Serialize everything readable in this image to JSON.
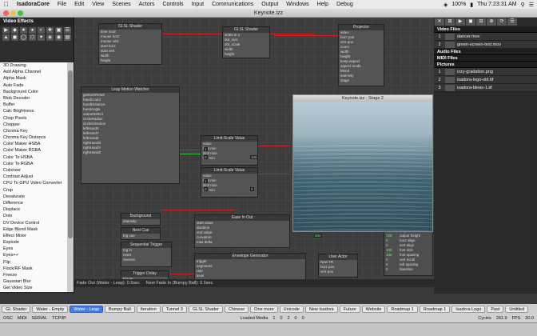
{
  "menubar": {
    "app_name": "IsadoraCore",
    "items": [
      "File",
      "Edit",
      "View",
      "Scenes",
      "Actors",
      "Controls",
      "Input",
      "Communications",
      "Output",
      "Windows",
      "Help",
      "Debug"
    ],
    "battery": "100%",
    "clock": "Thu 7:23:31 AM"
  },
  "window": {
    "title": "Keynote.izz"
  },
  "left_panel": {
    "title": "Video Effects",
    "icons": [
      "▶",
      "◆",
      "★",
      "●",
      "◐",
      "✚",
      "▣",
      "☰",
      "▲",
      "◼",
      "◯",
      "⬡",
      "✦",
      "◈",
      "◉",
      "▤"
    ],
    "actors": [
      "3D Drawing",
      "Add Alpha Channel",
      "Alpha Mask",
      "Auto Fade",
      "Background Color",
      "Blob Decoder",
      "Buffer",
      "Calc Brightness",
      "Chop Pixels",
      "Chopper",
      "Chroma Key",
      "Chroma Key Distance",
      "Color Maker HSBA",
      "Color Maker RGBA",
      "Color To HSBA",
      "Color To RGBA",
      "Colorizer",
      "Contrast Adjust",
      "CPU To GPU Video Converter",
      "Crop",
      "Desaturate",
      "Difference",
      "Displace",
      "Dots",
      "DV Device Control",
      "Edge Blend Mask",
      "Effect Mixer",
      "Explode",
      "Eyes",
      "Eyes++",
      "Flip",
      "Flock/RF Mask",
      "Freeze",
      "Gaussian Blur",
      "Get Video Size"
    ]
  },
  "patch": {
    "actors": [
      {
        "title": "GLSL Shader",
        "rows": [
          "time mod",
          "mouse horz",
          "mouse vert",
          "start horz",
          "start vert",
          "width",
          "height"
        ]
      },
      {
        "title": "GLSL Shader",
        "rows": [
          "video in 1",
          "dot_size",
          "dot_scale",
          "width",
          "height"
        ]
      },
      {
        "title": "Projector",
        "rows": [
          "video",
          "horz pos",
          "vert pos",
          "zoom",
          "width",
          "height",
          "keep aspect",
          "aspect mode",
          "blend",
          "intensity",
          "stage"
        ]
      },
      {
        "title": "Leap Motion Watcher",
        "rows": [
          "gestureReset",
          "handCount",
          "handDistance",
          "handAngle",
          "outputSelect",
          "circleRadius",
          "circleDirection",
          "leftHandX",
          "leftHandY",
          "leftHandZ",
          "rightHandX",
          "rightHandY",
          "rightHandZ"
        ]
      },
      {
        "title": "Limit-Scale Value",
        "rows": [
          "value",
          "limit min",
          "limit max",
          "out min",
          "out max"
        ]
      },
      {
        "title": "Limit-Scale Value",
        "rows": [
          "value",
          "limit min",
          "limit max",
          "out min",
          "out max"
        ]
      },
      {
        "title": "Background",
        "rows": [
          "intensity"
        ]
      },
      {
        "title": "Next Cue",
        "rows": [
          "trig cue"
        ]
      },
      {
        "title": "Sequential Trigger",
        "rows": [
          "trig in",
          "reset",
          "reverse",
          "output"
        ]
      },
      {
        "title": "Trigger Delay",
        "rows": [
          "trigger",
          "delay"
        ]
      },
      {
        "title": "Ease In Out",
        "rows": [
          "start value",
          "duration",
          "end value",
          "curvature",
          "max delta",
          "trigger"
        ]
      },
      {
        "title": "Envelope Generator",
        "rows": [
          "trigger",
          "segments",
          "rate",
          "level",
          "value 0",
          "value 1"
        ]
      },
      {
        "title": "User Actor",
        "rows": [
          "New TR",
          "horz pos",
          "vert pos",
          "alpha"
        ]
      }
    ],
    "value_labels": [
      "1",
      "0",
      "1",
      "0",
      "100",
      "0",
      "100",
      "500"
    ],
    "scene_fade": "Fade Out (Water - Leap): 0.5sec",
    "scene_fade_in": "Next Fade In (Bumpy Ball): 0.5sec"
  },
  "stage": {
    "title": "Keynote.izz : Stage 2"
  },
  "media": {
    "tools": [
      "✕",
      "⊞",
      "▶",
      "◼",
      "⊟",
      "⊕",
      "⟳",
      "☰"
    ],
    "sections": [
      {
        "title": "Video Files",
        "items": [
          {
            "num": "1",
            "name": "dancer.mov"
          },
          {
            "num": "2",
            "name": "green-screen-test.mov"
          }
        ]
      },
      {
        "title": "Audio Files",
        "items": []
      },
      {
        "title": "MIDI Files",
        "items": []
      },
      {
        "title": "Pictures",
        "items": [
          {
            "num": "1",
            "name": "izzy-gradation.png"
          },
          {
            "num": "2",
            "name": "isadora-logo-old.tif"
          },
          {
            "num": "3",
            "name": "isadora-bleas-1.tif"
          }
        ]
      }
    ]
  },
  "inspector": {
    "rows": [
      [
        "1280",
        "output width"
      ],
      [
        "720",
        "output height"
      ],
      [
        "0",
        "horz align"
      ],
      [
        "0",
        "vert align"
      ],
      [
        "100",
        "font size"
      ],
      [
        "100",
        "font spacing"
      ],
      [
        "0",
        "vert scroll"
      ],
      [
        "0",
        "tab spacing"
      ],
      [
        "0",
        "baseline"
      ]
    ]
  },
  "scene_tabs": [
    "GL Shader",
    "Water - Empty",
    "Water - Leap",
    "Bumpy Ball",
    "Iteration",
    "Tunnel 3",
    "GLSL Shader",
    "Chinese",
    "One more",
    "Unicode",
    "New Isadora",
    "Future",
    "Website",
    "Roadmap 1",
    "Roadmap 1",
    "Isadora Logo",
    "Past",
    "Untitled"
  ],
  "active_scene": "Water - Leap",
  "statusbar": {
    "left": [
      "OSC",
      "MIDI",
      "SERIAL",
      "TCP/IP"
    ],
    "loaded_media_label": "Loaded Media",
    "loaded_media_value": "1",
    "counts": [
      "0",
      "2",
      "0",
      "0"
    ],
    "cycles_label": "Cycles",
    "cycles_value": "261.9",
    "fps_label": "FPS",
    "fps_value": "30.0"
  }
}
